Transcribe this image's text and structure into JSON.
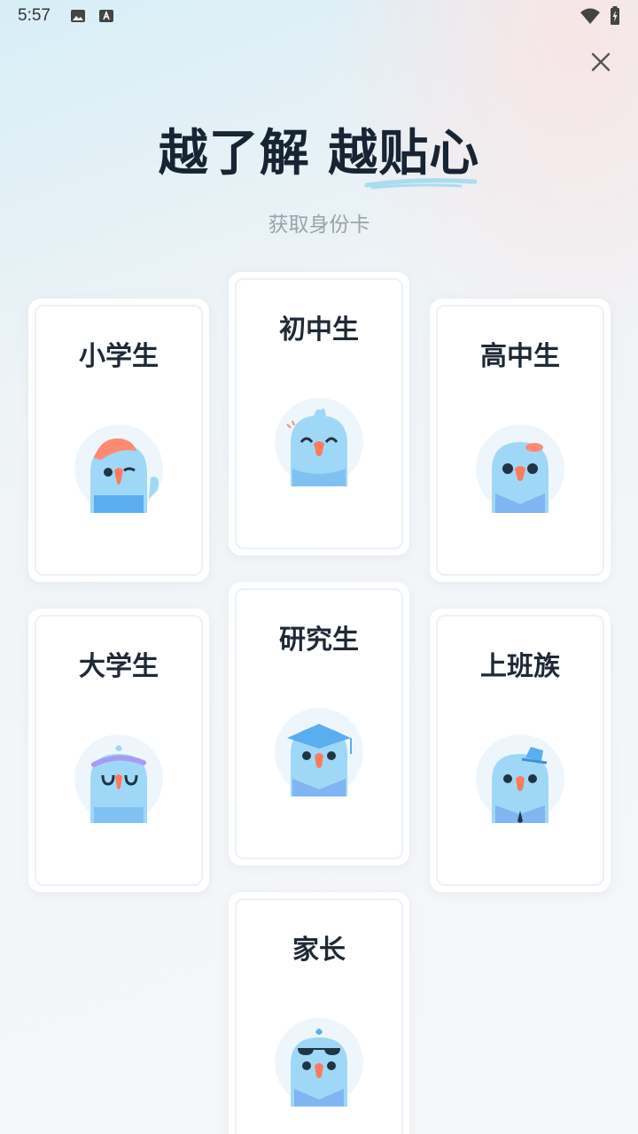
{
  "status_bar": {
    "time": "5:57"
  },
  "header": {
    "title_part1": "越了解",
    "title_part2": "越贴心",
    "subtitle": "获取身份卡"
  },
  "cards": [
    {
      "label": "小学生",
      "avatar": "bird-cap-avatar"
    },
    {
      "label": "初中生",
      "avatar": "bird-happy-avatar"
    },
    {
      "label": "高中生",
      "avatar": "bird-beret-avatar"
    },
    {
      "label": "大学生",
      "avatar": "bird-headband-avatar"
    },
    {
      "label": "研究生",
      "avatar": "bird-graduation-cap-avatar"
    },
    {
      "label": "上班族",
      "avatar": "bird-hat-tie-avatar"
    },
    {
      "label": "家长",
      "avatar": "bird-sunglasses-avatar"
    }
  ],
  "colors": {
    "title": "#172433",
    "subtitle": "#9aa2aa",
    "bird": "#8fd0f5",
    "bird_dark": "#5aaef0",
    "beak": "#ff7a5c"
  }
}
